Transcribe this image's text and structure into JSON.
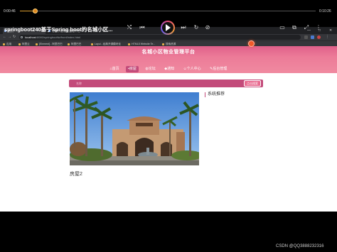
{
  "browser": {
    "tabs": [
      {
        "label": "首页"
      },
      {
        "label": "名城小区物业管理平台"
      }
    ],
    "new_tab": "+",
    "window_controls": {
      "minimize": "—",
      "maximize": "□",
      "close": "✕"
    },
    "url_host": "localhost",
    "url_path": ":8080/springbootfw/front/index.html",
    "bookmarks": [
      "应用",
      "阿里云",
      "[Element] - 阿里巴巴",
      "阿里巴巴",
      "Layui - 经典开源模块化",
      "HTML5 Website Te...",
      "搜索资源"
    ],
    "icons": [
      "back-icon",
      "forward-icon",
      "reload-icon",
      "star-icon",
      "extension-icon",
      "profile-icon",
      "menu-icon"
    ]
  },
  "site": {
    "title": "名城小区物业管理平台",
    "nav": [
      {
        "label": "首页",
        "icon": "home-icon",
        "active": false
      },
      {
        "label": "房屋",
        "icon": "house-icon",
        "active": true
      },
      {
        "label": "论坛",
        "icon": "forum-icon",
        "active": false
      },
      {
        "label": "通知",
        "icon": "bell-icon",
        "active": false
      },
      {
        "label": "个人中心",
        "icon": "user-icon",
        "active": false
      },
      {
        "label": "后台管理",
        "icon": "admin-icon",
        "active": false
      }
    ],
    "search_placeholder": "名称",
    "search_button": "点击搜索",
    "house_caption": "房屋2",
    "recommend_title": "系统推荐",
    "colors": {
      "header": "#ec7b98",
      "accent": "#c34b7a",
      "cursor": "#f05a2a"
    }
  },
  "player": {
    "time_current": "0:00:46",
    "time_total": "0:10:26",
    "progress": 0.05,
    "video_title": "springboot240基于Spring boot的名城小区...",
    "controls": {
      "shuffle": "⤭",
      "prev": "⏮",
      "next": "⏭",
      "loop": "↻",
      "danmaku": "⊘",
      "screen": "▭",
      "pip": "⧉",
      "fullscreen": "⤢",
      "more": "⋮"
    }
  },
  "watermark": "CSDN @QQ3888232316"
}
